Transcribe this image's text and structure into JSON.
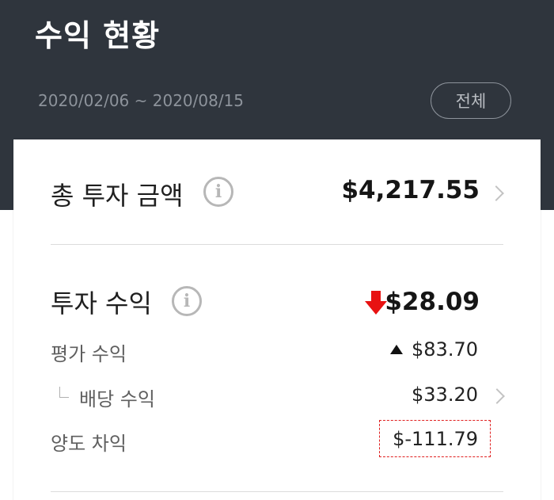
{
  "header": {
    "title": "수익 현황",
    "date_range": "2020/02/06 ~ 2020/08/15",
    "period_button_label": "전체"
  },
  "total_investment": {
    "label": "총 투자 금액",
    "value": "$4,217.55"
  },
  "investment_profit": {
    "label": "투자 수익",
    "value": "$28.09",
    "trend": "down",
    "trend_color": "#e81212"
  },
  "details": {
    "valuation_profit_label": "평가 수익",
    "valuation_profit_value": "$83.70",
    "valuation_trend": "up",
    "dividend_label": "배당 수익",
    "dividend_value": "$33.20",
    "capital_gain_label": "양도 차익",
    "capital_gain_value": "$-111.79"
  },
  "colors": {
    "header_background": "#2f353d",
    "highlight_border": "#e02020"
  }
}
